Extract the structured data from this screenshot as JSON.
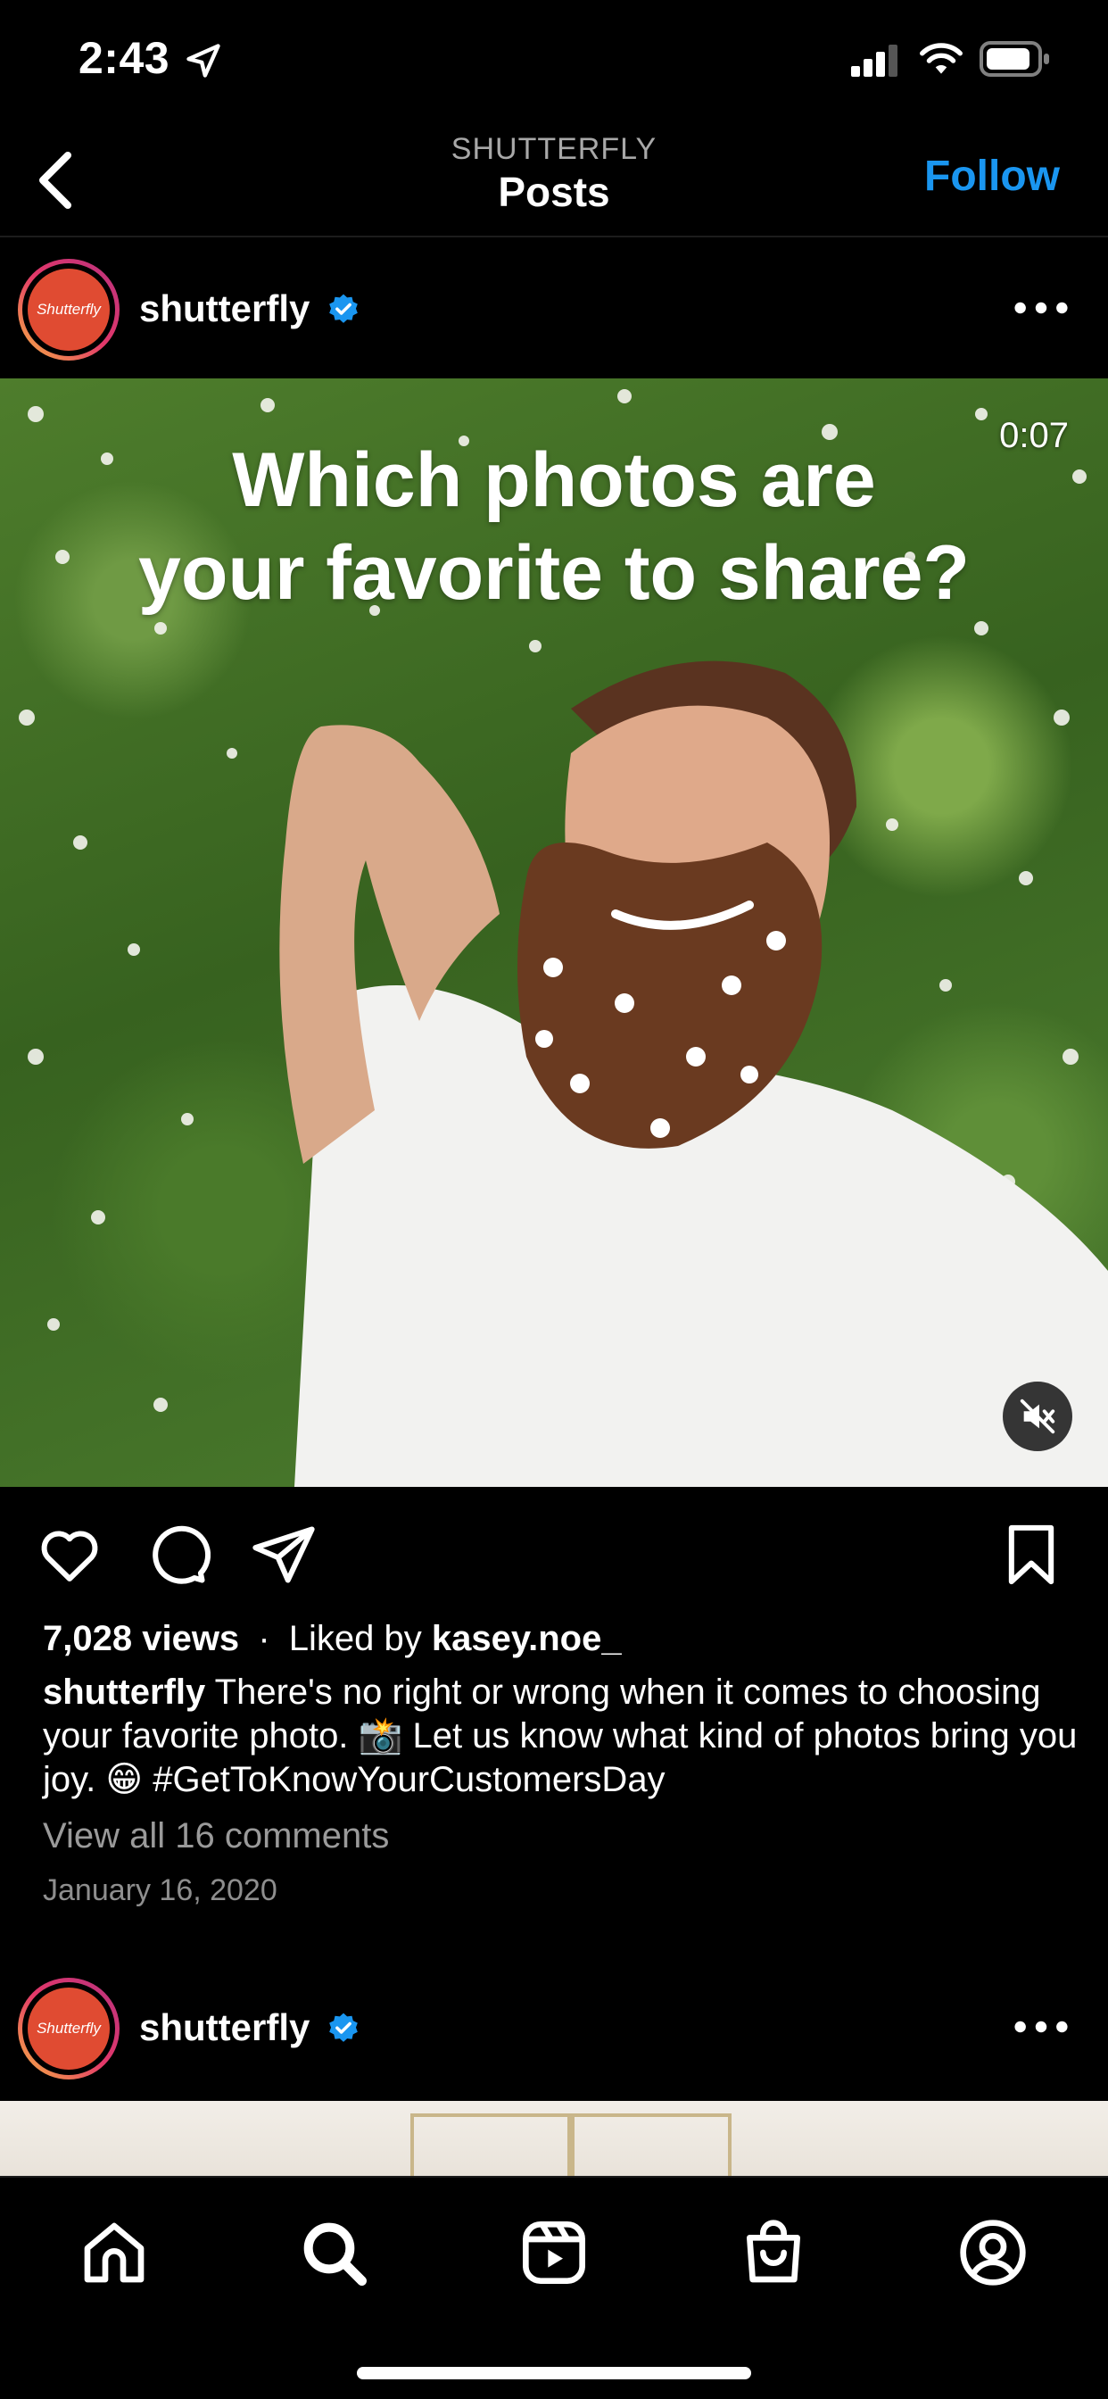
{
  "status_bar": {
    "time": "2:43"
  },
  "header": {
    "eyebrow": "SHUTTERFLY",
    "title": "Posts",
    "follow_label": "Follow"
  },
  "post": {
    "avatar_text": "Shutterfly",
    "username": "shutterfly",
    "duration": "0:07",
    "overlay_line1": "Which photos are",
    "overlay_line2": "your favorite to share?",
    "views": "7,028 views",
    "separator": "·",
    "liked_by_prefix": "Liked by",
    "liked_by_user": "kasey.noe_",
    "caption_user": "shutterfly",
    "caption_text": "There's no right or wrong when it comes to choosing your favorite photo. 📸 Let us know what kind of photos bring you joy. 😁 #GetToKnowYourCustomersDay",
    "view_comments": "View all 16 comments",
    "date": "January 16, 2020"
  },
  "next_post": {
    "avatar_text": "Shutterfly",
    "username": "shutterfly"
  },
  "tabs": [
    {
      "name": "home-icon"
    },
    {
      "name": "search-icon"
    },
    {
      "name": "reels-icon"
    },
    {
      "name": "shop-icon"
    },
    {
      "name": "profile-icon"
    }
  ],
  "colors": {
    "accent": "#1a96f0",
    "verified": "#1a96f0",
    "brand": "#e04b32"
  }
}
